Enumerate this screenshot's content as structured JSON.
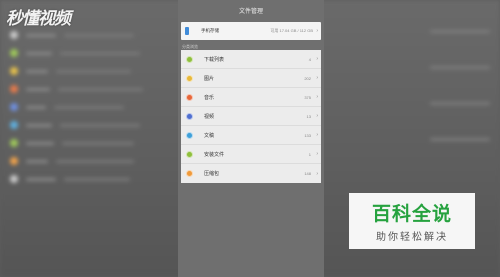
{
  "watermark": {
    "text": "秒懂视频"
  },
  "panel": {
    "title": "文件管理",
    "storage": {
      "label": "手机存储",
      "info": "可用 17.04 GB / 112 GB",
      "icon": "phone-icon",
      "icon_color": "#3f8bd9"
    },
    "section_header": "分类浏览",
    "categories": [
      {
        "label": "下载列表",
        "count": "4",
        "icon": "download-icon",
        "color": "#8fbf3c"
      },
      {
        "label": "图片",
        "count": "202",
        "icon": "image-icon",
        "color": "#e8b93a"
      },
      {
        "label": "音乐",
        "count": "375",
        "icon": "music-icon",
        "color": "#e8673a"
      },
      {
        "label": "视频",
        "count": "13",
        "icon": "video-icon",
        "color": "#4f6fd0"
      },
      {
        "label": "文稿",
        "count": "133",
        "icon": "document-icon",
        "color": "#3fa0d9"
      },
      {
        "label": "安装文件",
        "count": "1",
        "icon": "package-icon",
        "color": "#8fbf3c"
      },
      {
        "label": "压缩包",
        "count": "148",
        "icon": "archive-icon",
        "color": "#f09a3a"
      }
    ],
    "chevron": "›"
  },
  "badge": {
    "main": "百科全说",
    "sub": "助你轻松解决",
    "accent": "#26a23f"
  }
}
